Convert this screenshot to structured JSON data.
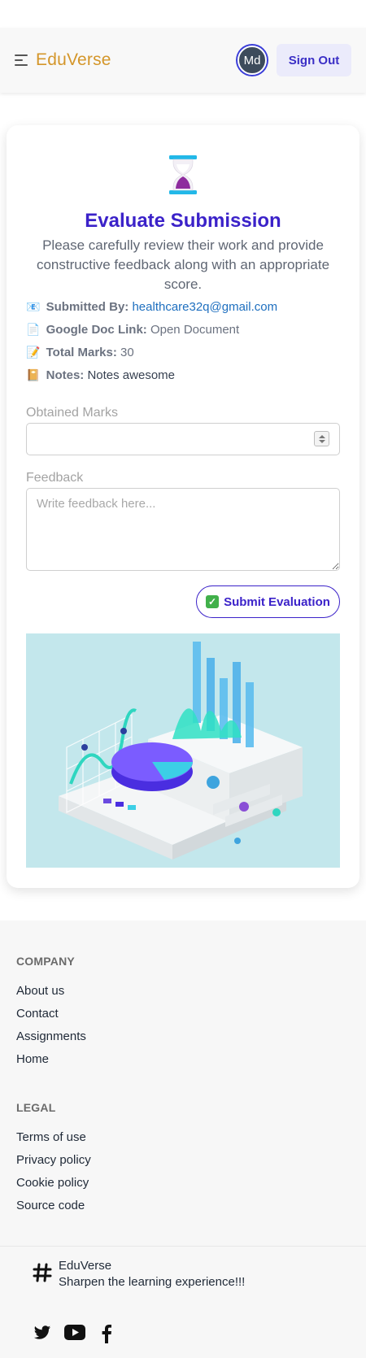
{
  "navbar": {
    "brand": "EduVerse",
    "avatar_initials": "Md",
    "signout_label": "Sign Out",
    "brand_color": "#d4962a",
    "accent_color": "#3b22c9"
  },
  "card": {
    "title": "Evaluate Submission",
    "subtitle": "Please carefully review their work and provide constructive feedback along with an appropriate score.",
    "submitted_by": {
      "emoji": "📧",
      "label": "Submitted By:",
      "value": "healthcare32q@gmail.com"
    },
    "doc_link": {
      "emoji": "📄",
      "label": "Google Doc Link:",
      "value": "Open Document"
    },
    "total_marks": {
      "emoji": "📝",
      "label": "Total Marks:",
      "value": "30"
    },
    "notes": {
      "emoji": "📔",
      "label": "Notes:",
      "value": "Notes awesome"
    },
    "obtained_marks_label": "Obtained Marks",
    "obtained_marks_value": "",
    "feedback_label": "Feedback",
    "feedback_placeholder": "Write feedback here...",
    "submit_label": "Submit Evaluation"
  },
  "footer": {
    "company_heading": "COMPANY",
    "company_links": [
      "About us",
      "Contact",
      "Assignments",
      "Home"
    ],
    "legal_heading": "LEGAL",
    "legal_links": [
      "Terms of use",
      "Privacy policy",
      "Cookie policy",
      "Source code"
    ],
    "brand": "EduVerse",
    "tagline": "Sharpen the learning experience!!!",
    "social_icons": [
      "twitter-icon",
      "youtube-icon",
      "facebook-icon"
    ]
  }
}
